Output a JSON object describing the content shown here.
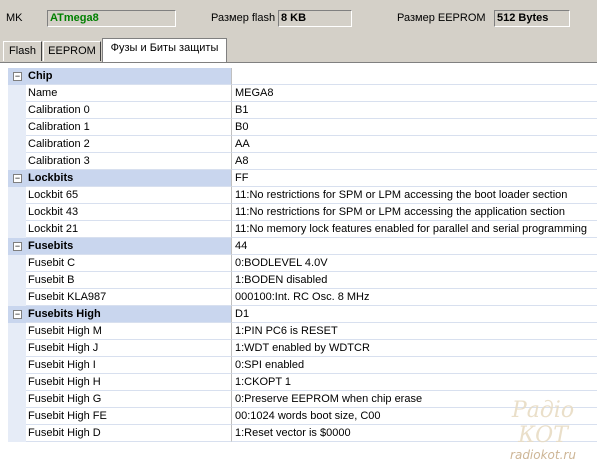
{
  "header": {
    "mk_label": "MK",
    "mk_value": "ATmega8",
    "flash_label": "Размер flash",
    "flash_value": "8 KB",
    "eeprom_label": "Размер EEPROM",
    "eeprom_value": "512 Bytes"
  },
  "tabs": [
    {
      "label": "Flash",
      "active": false
    },
    {
      "label": "EEPROM",
      "active": false
    },
    {
      "label": "Фузы и Биты защиты",
      "active": true
    }
  ],
  "rows": [
    {
      "type": "cat",
      "name": "Chip",
      "value": ""
    },
    {
      "type": "item",
      "name": "Name",
      "value": "MEGA8"
    },
    {
      "type": "item",
      "name": "Calibration 0",
      "value": "B1"
    },
    {
      "type": "item",
      "name": "Calibration 1",
      "value": "B0"
    },
    {
      "type": "item",
      "name": "Calibration 2",
      "value": "AA"
    },
    {
      "type": "item",
      "name": "Calibration 3",
      "value": "A8"
    },
    {
      "type": "cat",
      "name": "Lockbits",
      "value": "FF"
    },
    {
      "type": "item",
      "name": "Lockbit 65",
      "value": "11:No restrictions for SPM or LPM accessing the boot loader section"
    },
    {
      "type": "item",
      "name": "Lockbit 43",
      "value": "11:No restrictions for SPM or LPM accessing the application section"
    },
    {
      "type": "item",
      "name": "Lockbit 21",
      "value": "11:No memory lock features enabled for parallel and serial programming"
    },
    {
      "type": "cat",
      "name": "Fusebits",
      "value": "44"
    },
    {
      "type": "item",
      "name": "Fusebit C",
      "value": "0:BODLEVEL 4.0V"
    },
    {
      "type": "item",
      "name": "Fusebit B",
      "value": "1:BODEN disabled"
    },
    {
      "type": "item",
      "name": "Fusebit KLA987",
      "value": "000100:Int. RC Osc. 8 MHz"
    },
    {
      "type": "cat",
      "name": "Fusebits High",
      "value": "D1"
    },
    {
      "type": "item",
      "name": "Fusebit High M",
      "value": "1:PIN PC6 is RESET"
    },
    {
      "type": "item",
      "name": "Fusebit High J",
      "value": "1:WDT enabled by WDTCR"
    },
    {
      "type": "item",
      "name": "Fusebit High I",
      "value": "0:SPI enabled"
    },
    {
      "type": "item",
      "name": "Fusebit High H",
      "value": "1:CKOPT 1"
    },
    {
      "type": "item",
      "name": "Fusebit High G",
      "value": "0:Preserve EEPROM when chip erase"
    },
    {
      "type": "item",
      "name": "Fusebit High FE",
      "value": "00:1024 words boot size, C00"
    },
    {
      "type": "item",
      "name": "Fusebit High D",
      "value": "1:Reset vector is $0000"
    }
  ],
  "collapse_glyph": "−",
  "watermark": {
    "main": "Радіо КОТ",
    "sub": "radiokot.ru"
  }
}
